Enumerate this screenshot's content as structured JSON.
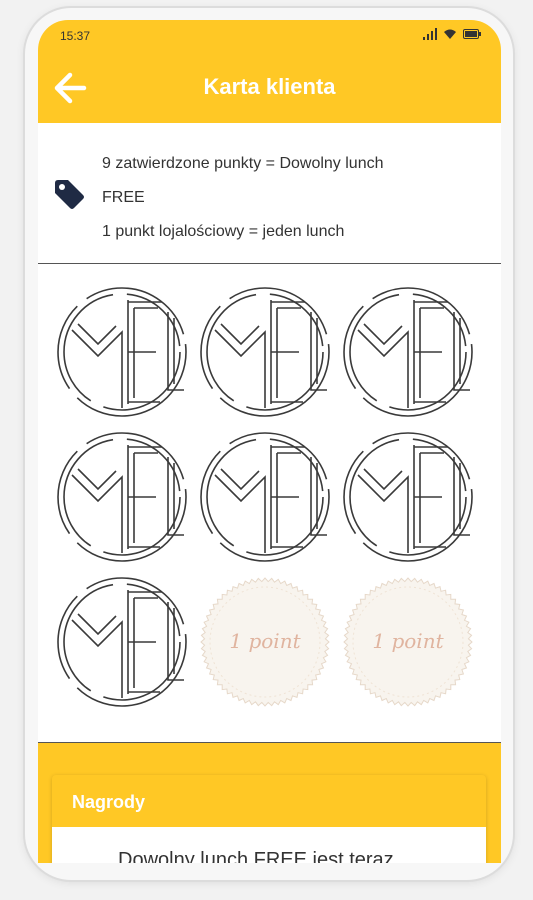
{
  "status_bar": {
    "time": "15:37"
  },
  "app_bar": {
    "title": "Karta klienta",
    "back_icon": "arrow-left-icon"
  },
  "info": {
    "line1": "9 zatwierdzone punkty = Dowolny lunch",
    "line2": "FREE",
    "line3": "1 punkt lojalościowy = jeden lunch",
    "icon": "tag-icon"
  },
  "stamps": {
    "logo_text": "MEL",
    "empty_label": "1 point",
    "total": 9,
    "collected": 7
  },
  "rewards": {
    "title": "Nagrody",
    "items": [
      {
        "text": "Dowolny lunch FREE jest teraz"
      }
    ]
  },
  "colors": {
    "accent": "#FFC825",
    "stamp_empty_fill": "#f8f4ee",
    "stamp_empty_text": "#e0b49f"
  }
}
